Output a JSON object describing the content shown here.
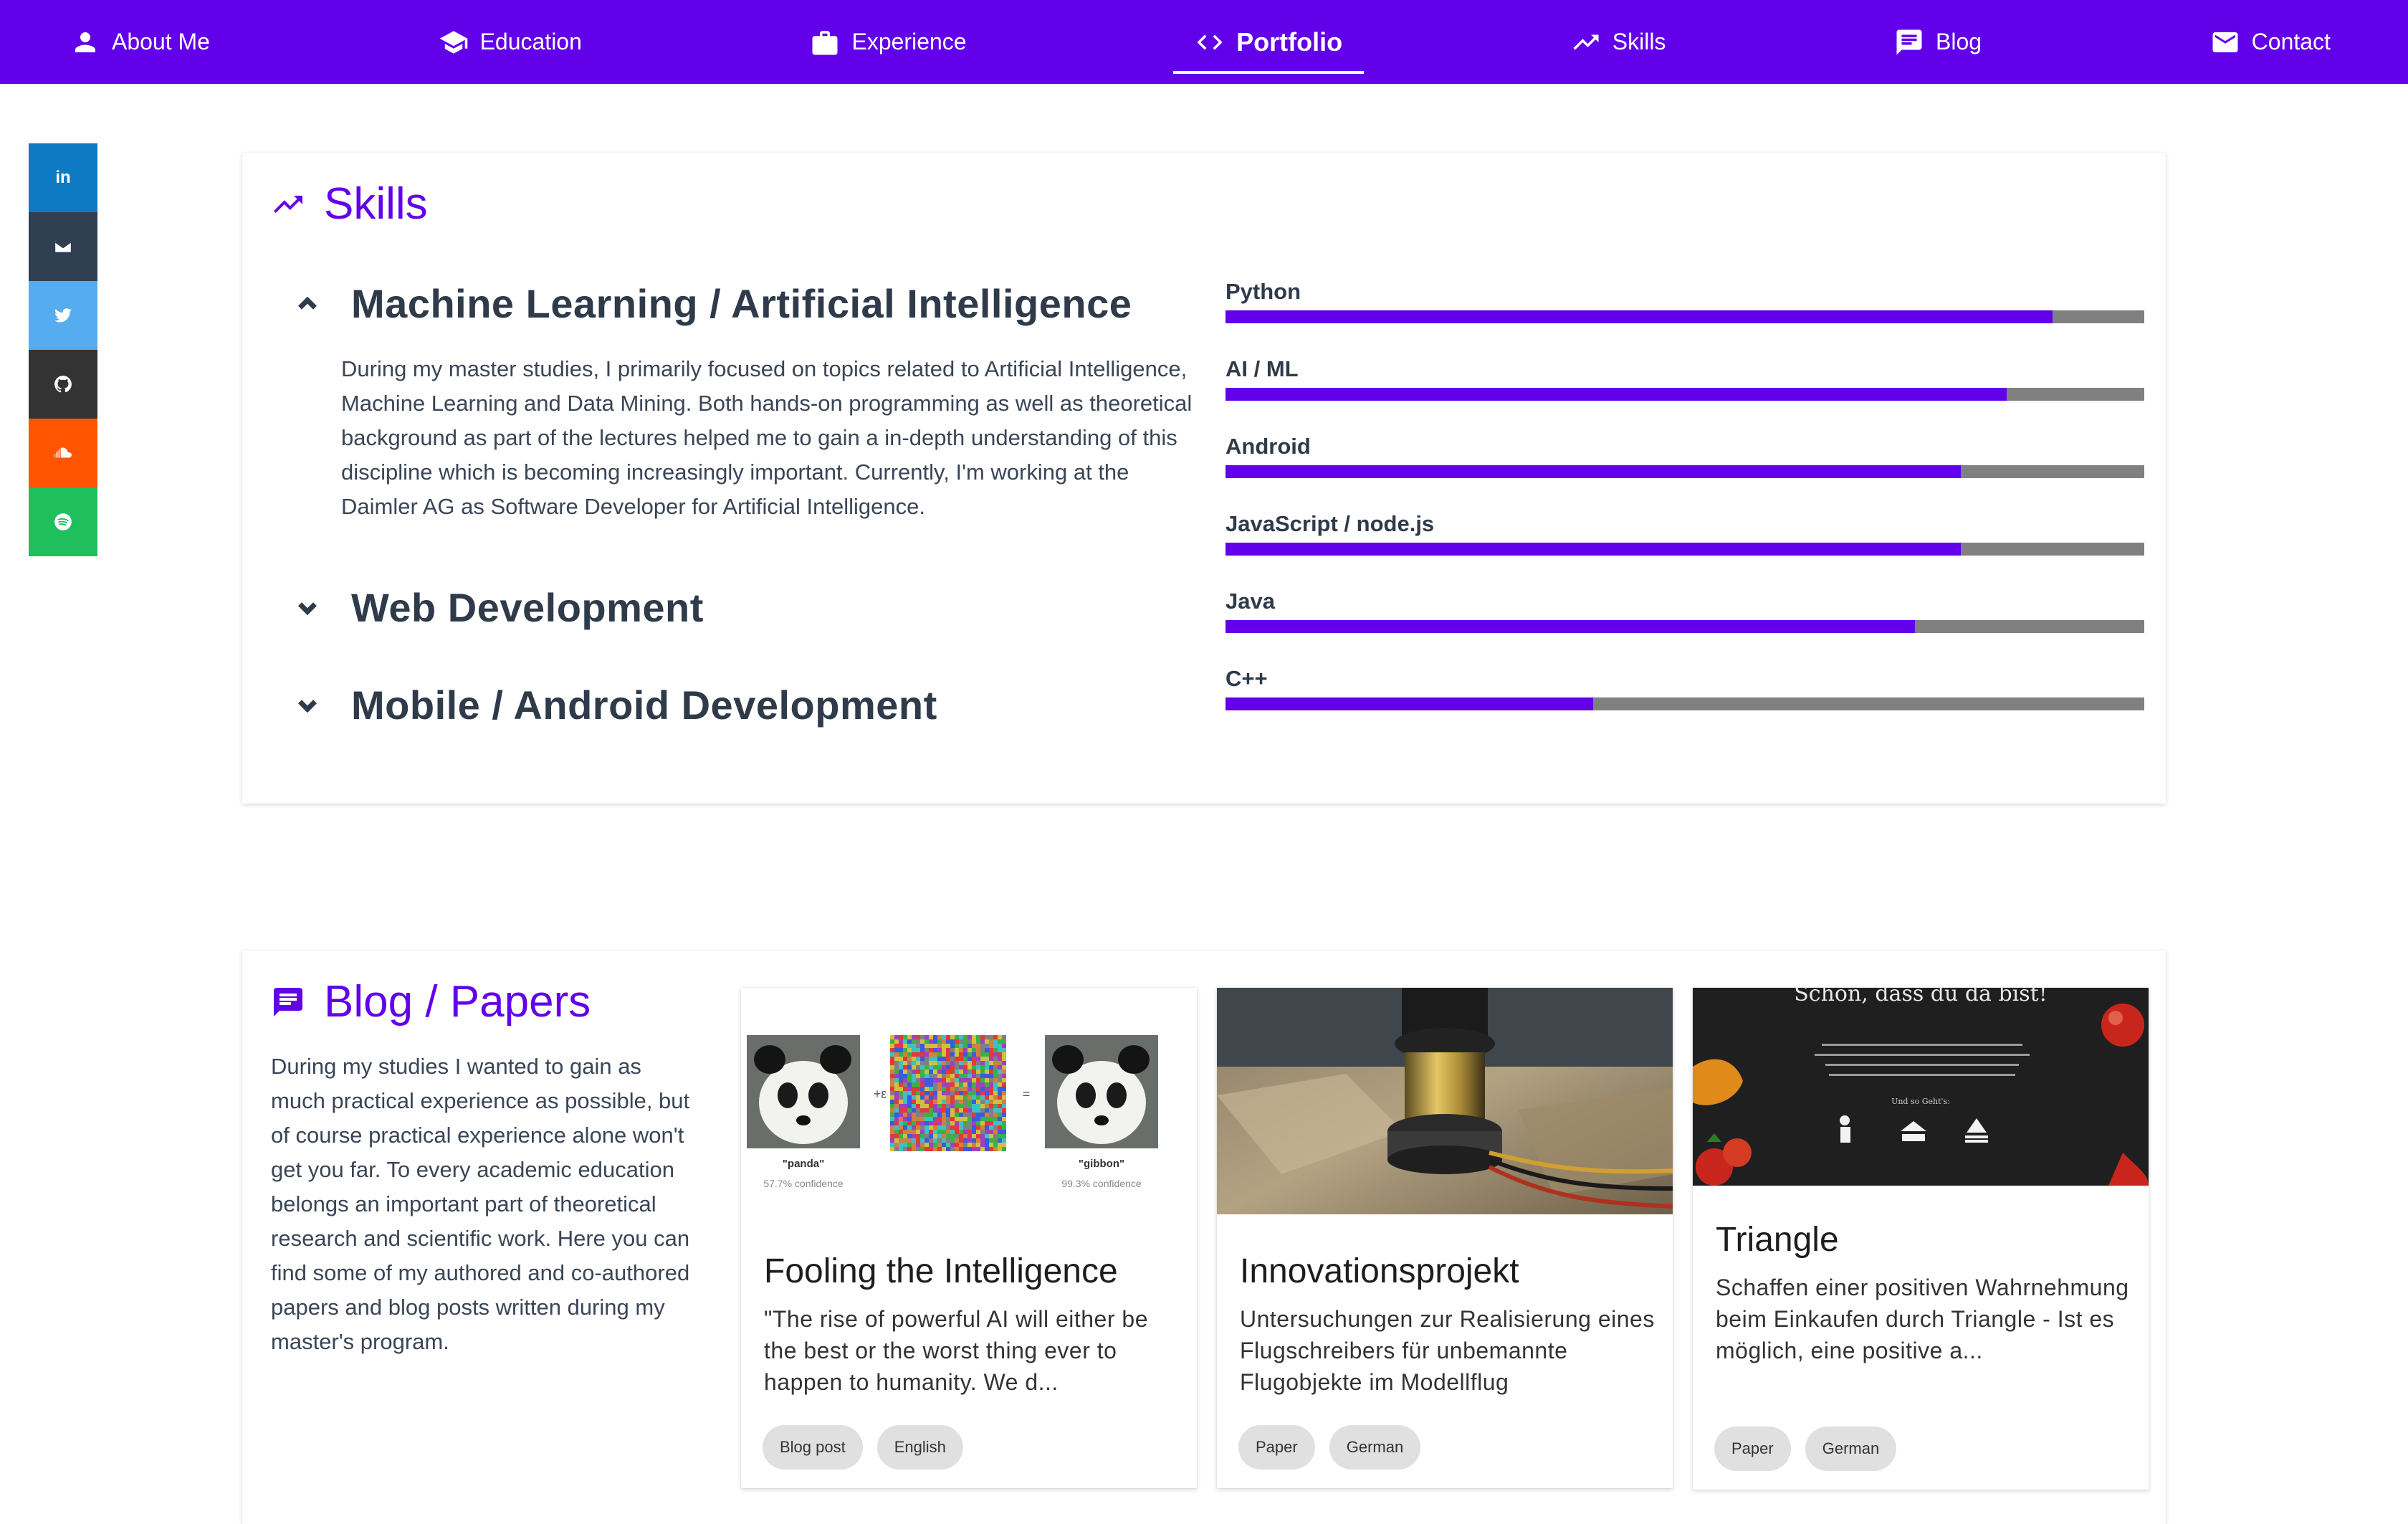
{
  "nav": {
    "items": [
      {
        "label": "About Me",
        "icon": "person-icon"
      },
      {
        "label": "Education",
        "icon": "school-icon"
      },
      {
        "label": "Experience",
        "icon": "briefcase-icon"
      },
      {
        "label": "Portfolio",
        "icon": "code-icon",
        "active": true
      },
      {
        "label": "Skills",
        "icon": "trending-up-icon"
      },
      {
        "label": "Blog",
        "icon": "comment-icon"
      },
      {
        "label": "Contact",
        "icon": "mail-icon"
      }
    ],
    "colors": {
      "background": "#6200ea",
      "text": "#ffffff"
    }
  },
  "social": [
    {
      "name": "linkedin",
      "label": "in",
      "color": "#0e7ac4"
    },
    {
      "name": "email",
      "color": "#2f3e50"
    },
    {
      "name": "twitter",
      "color": "#55acee"
    },
    {
      "name": "github",
      "color": "#333333"
    },
    {
      "name": "soundcloud",
      "color": "#ff5500"
    },
    {
      "name": "spotify",
      "color": "#1ebf5c"
    }
  ],
  "skills": {
    "title": "Skills",
    "categories": [
      {
        "title": "Machine Learning / Artificial Intelligence",
        "expanded": true,
        "description": "During my master studies, I primarily focused on topics related to Artificial Intelligence, Machine Learning and Data Mining. Both hands-on programming as well as theoretical background as part of the lectures helped me to gain a in-depth understanding of this discipline which is becoming increasingly important. Currently, I'm working at the Daimler AG as Software Developer for Artificial Intelligence."
      },
      {
        "title": "Web Development",
        "expanded": false
      },
      {
        "title": "Mobile / Android Development",
        "expanded": false
      }
    ],
    "bars": [
      {
        "label": "Python",
        "level": 0.9
      },
      {
        "label": "AI / ML",
        "level": 0.85
      },
      {
        "label": "Android",
        "level": 0.8
      },
      {
        "label": "JavaScript / node.js",
        "level": 0.8
      },
      {
        "label": "Java",
        "level": 0.75
      },
      {
        "label": "C++",
        "level": 0.4
      }
    ],
    "colors": {
      "fill": "#6200ea",
      "track": "#808080"
    }
  },
  "blog": {
    "title": "Blog / Papers",
    "intro": "During my studies I wanted to gain as much practical experience as possible, but of course practical experience alone won't get you far. To every academic education belongs an important part of theoretical research and scientific work. Here you can find some of my authored and co-authored papers and blog posts written during my master's program.",
    "posts": [
      {
        "title": "Fooling the Intelligence",
        "description": "\"The rise of powerful AI will either be the best or the worst thing ever to happen to humanity. We d...",
        "tags": [
          "Blog post",
          "English"
        ],
        "image": {
          "left_label": "\"panda\"",
          "left_conf": "57.7% confidence",
          "op1": "+ε",
          "op2": "=",
          "right_label": "\"gibbon\"",
          "right_conf": "99.3% confidence"
        }
      },
      {
        "title": "Innovationsprojekt",
        "description": "Untersuchungen zur Realisierung eines Flugschreibers für unbemannte Flugobjekte im Modellflug",
        "tags": [
          "Paper",
          "German"
        ]
      },
      {
        "title": "Triangle",
        "description": "Schaffen einer positiven Wahrnehmung beim Einkaufen durch Triangle - Ist es möglich, eine positive a...",
        "tags": [
          "Paper",
          "German"
        ],
        "image": {
          "headline": "Schön, dass du da bist!",
          "sub": "Und so Geht's:"
        }
      }
    ]
  }
}
